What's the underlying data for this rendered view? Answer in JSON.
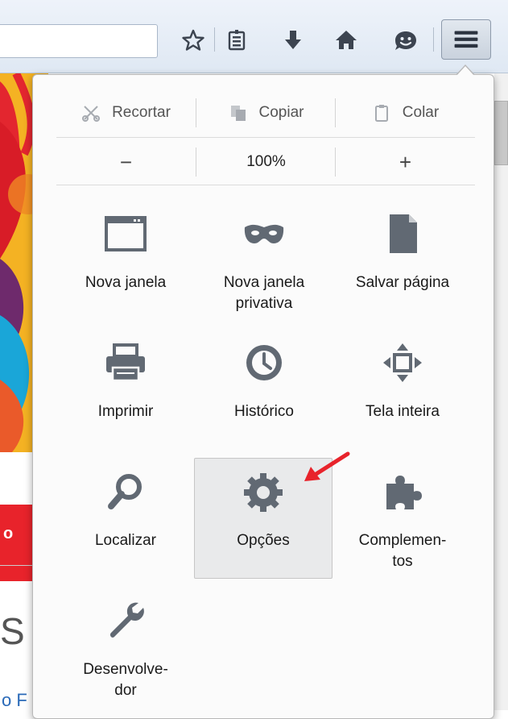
{
  "edit": {
    "cut_label": "Recortar",
    "copy_label": "Copiar",
    "paste_label": "Colar"
  },
  "zoom": {
    "minus": "−",
    "level": "100%",
    "plus": "+"
  },
  "grid": [
    {
      "label": "Nova janela",
      "icon": "window-icon"
    },
    {
      "label": "Nova janela\nprivativa",
      "icon": "private-mask-icon"
    },
    {
      "label": "Salvar página",
      "icon": "save-page-icon"
    },
    {
      "label": "Imprimir",
      "icon": "printer-icon"
    },
    {
      "label": "Histórico",
      "icon": "history-clock-icon"
    },
    {
      "label": "Tela inteira",
      "icon": "fullscreen-icon"
    },
    {
      "label": "Localizar",
      "icon": "search-icon"
    },
    {
      "label": "Opções",
      "icon": "gear-icon",
      "highlighted": true
    },
    {
      "label": "Complemen-\ntos",
      "icon": "puzzle-icon"
    },
    {
      "label": "Desenvolve-\ndor",
      "icon": "wrench-icon"
    }
  ],
  "background_page": {
    "bar_letter": "o",
    "big_letter": "S",
    "bottom_text": "o F"
  },
  "colors": {
    "icon_gray": "#616973",
    "annotation_arrow": "#e8232b",
    "highlight_bg": "#e9eaeb"
  }
}
